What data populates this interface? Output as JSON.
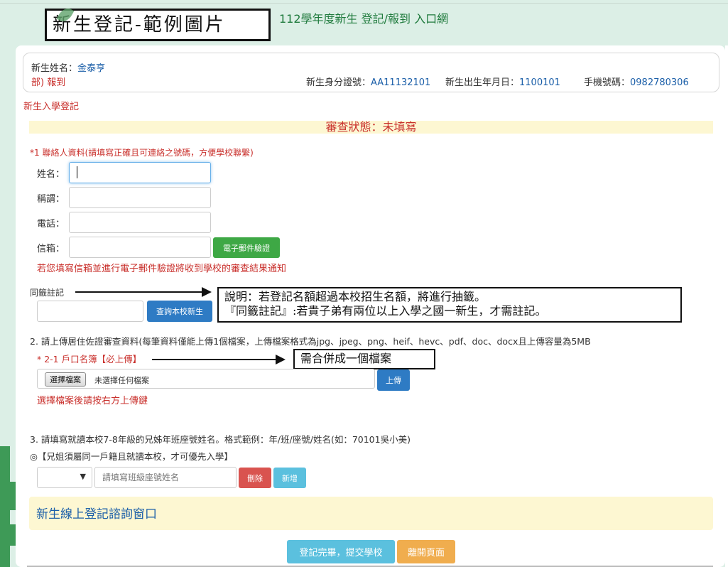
{
  "header": {
    "stamp_title": "新生登記-範例圖片",
    "site_title": "112學年度新生 登記/報到 入口網"
  },
  "student": {
    "name_label": "新生姓名：",
    "name_value": "金泰亨",
    "dept_text": "部) 報到",
    "id_label": "新生身分證號：",
    "id_value": "AA11132101",
    "birth_label": "新生出生年月日：",
    "birth_value": "1100101",
    "phone_label": "手機號碼：",
    "phone_value": "0982780306"
  },
  "section_title": "新生入學登記",
  "review_status": "審查狀態：未填寫",
  "contact": {
    "heading": "*1 聯絡人資料(請填寫正確且可連絡之號碼，方便學校聯繫)",
    "name_label": "姓名：",
    "title_label": "稱謂：",
    "phone_label": "電話：",
    "email_label": "信箱：",
    "verify_button": "電子郵件驗證",
    "email_note": "若您填寫信箱並進行電子郵件驗證將收到學校的審查結果通知"
  },
  "lottery": {
    "label": "同籤註記",
    "query_button": "查詢本校新生",
    "note_line1": "說明：若登記名額超過本校招生名額，將進行抽籤。",
    "note_line2": "『同籤註記』:若貴子弟有兩位以上入學之國一新生，才需註記。"
  },
  "upload": {
    "heading": "2. 請上傳居住佐證審查資料(每筆資料僅能上傳1個檔案，上傳檔案格式為jpg、jpeg、png、heif、hevc、pdf、doc、docx且上傳容量為5MB",
    "sub_heading": "* 2-1 戶口名簿【必上傳】",
    "merge_note": "需合併成一個檔案",
    "choose_button": "選擇檔案",
    "file_status": "未選擇任何檔案",
    "upload_button": "上傳",
    "hint": "選擇檔案後請按右方上傳鍵"
  },
  "siblings": {
    "heading": "3. 請填寫就讀本校7-8年級的兄姊年班座號姓名。格式範例：年/班/座號/姓名(如：70101吳小美)",
    "note": "◎【兄姐須屬同一戶籍且就讀本校，才可優先入學】",
    "input_placeholder": "請填寫班級座號姓名",
    "delete_button": "刪除",
    "add_button": "新增"
  },
  "consult_title": "新生線上登記諮詢窗口",
  "footer": {
    "submit_button": "登記完畢，提交學校",
    "leave_button": "離開頁面"
  },
  "colors": {
    "accent_red": "#c9302c",
    "link_blue": "#1a5ea8",
    "banner_yellow": "#fdf7d2",
    "brand_green": "#1e7a3c"
  }
}
